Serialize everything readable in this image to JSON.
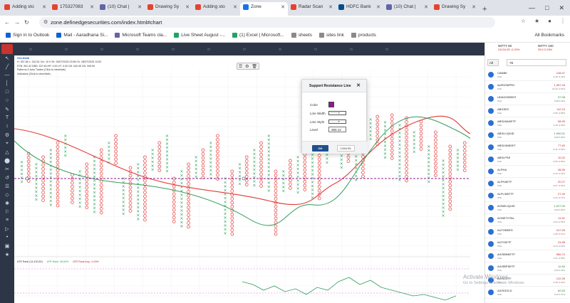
{
  "browser": {
    "tabs": [
      {
        "label": "Adding sto",
        "color": "#e5432f"
      },
      {
        "label": "175327083",
        "color": "#e5432f"
      },
      {
        "label": "(10) Chat |",
        "color": "#6264a7"
      },
      {
        "label": "Drawing Sy",
        "color": "#e5432f"
      },
      {
        "label": "Adding sto",
        "color": "#e5432f"
      },
      {
        "label": "Zone",
        "color": "#1a73e8",
        "active": true
      },
      {
        "label": "Radar Scan",
        "color": "#e5432f"
      },
      {
        "label": "HDFC Bank",
        "color": "#004c8f"
      },
      {
        "label": "(10) Chat |",
        "color": "#6264a7"
      },
      {
        "label": "Drawing Sy",
        "color": "#e5432f"
      }
    ],
    "url": "zone.definedgesecurities.com/index.html#chart",
    "bookmarks": [
      {
        "label": "Sign in to Outlook",
        "color": "#0a64d6"
      },
      {
        "label": "Mail - Aaradhana Si...",
        "color": "#0a64d6"
      },
      {
        "label": "Microsoft Teams cla...",
        "color": "#6264a7"
      },
      {
        "label": "Live Sheet August -...",
        "color": "#21a366"
      },
      {
        "label": "(1) Excel | Microsoft...",
        "color": "#21a366"
      },
      {
        "label": "sheets",
        "color": "#8a8a8a"
      },
      {
        "label": "sites link",
        "color": "#8a8a8a"
      },
      {
        "label": "products",
        "color": "#8a8a8a"
      }
    ],
    "all_bookmarks": "All Bookmarks"
  },
  "nav": {
    "items": [
      "",
      "",
      "",
      "",
      "",
      "",
      "",
      "",
      "",
      "",
      ""
    ]
  },
  "chart": {
    "symbol": "GOLDIAM",
    "line2": "H: 357.86 L: 342.81 Cm: 10 H Dr: 28/07/2025 23:58 Ch: 28/07/2025 13:53",
    "line3": "ETB: 351.42 DBD: 337.69 HP: 0.00 LP: 0.00 CB: 340.45 CB: 345.99",
    "line4": "Patterns & Auto Trades (Click to view/hide)",
    "line5": "Indicators (Click to view/hide)",
    "osc_label": "ATR Rank (14,100,50)",
    "osc_atr": "ATR Rank: 38.84%",
    "osc_avg": "ATR Rank Avg: -0.09%",
    "sr_level": 350.12,
    "colors": {
      "red": "#e53935",
      "green": "#2e9d5b",
      "sr": "#8e1a8e"
    }
  },
  "dialog": {
    "title": "Support Resistance Line",
    "color_label": "Color",
    "width_label": "Line Width",
    "style_label": "Line Style",
    "level_label": "Level",
    "level_value": "350.12",
    "ok": "OK",
    "cancel": "CANCEL",
    "swatch_color": "#8e1a8e"
  },
  "watchlist": {
    "nifty50": {
      "name": "NIFTY 50",
      "value": "24134.55 -0.20%"
    },
    "nifty100": {
      "name": "NIFTY 100",
      "value": "25.0 0.25%"
    },
    "filter": "All",
    "search": "78",
    "items": [
      {
        "name": "CANBK",
        "sub": "NSE",
        "price": "108.47",
        "chg": "-0.48 -0.44%",
        "up": false
      },
      {
        "name": "AURIONPRO",
        "sub": "NSE",
        "price": "1,357.45",
        "chg": "34.45 -2.51%",
        "up": false
      },
      {
        "name": "UDAICEMENT",
        "sub": "NSE",
        "price": "37.08",
        "chg": "0.08 0.22%",
        "up": true
      },
      {
        "name": "ABGSEC",
        "sub": "NSE",
        "price": "112.19",
        "chg": "-0.65 -0.58%",
        "up": false
      },
      {
        "name": "ABSLBANETF",
        "sub": "NSE",
        "price": "58.99",
        "chg": "-0.18 -0.30%",
        "up": false
      },
      {
        "name": "ABSLLIQUID",
        "sub": "NSE",
        "price": "1,000.01",
        "chg": "0.00 0.00%",
        "up": true
      },
      {
        "name": "ABSLNN50ET",
        "sub": "NSE",
        "price": "77.60",
        "chg": "-0.41 -0.52%",
        "up": false
      },
      {
        "name": "ABSLPSE",
        "sub": "NSE",
        "price": "10.02",
        "chg": "-0.05 -0.50%",
        "up": false
      },
      {
        "name": "ALPHA",
        "sub": "NSE",
        "price": "38.55",
        "chg": "-0.12 -0.31%",
        "up": false
      },
      {
        "name": "ALPHAETF",
        "sub": "NSE",
        "price": "20.27",
        "chg": "-0.07 -0.34%",
        "up": false
      },
      {
        "name": "ALPL30IETF",
        "sub": "NSE",
        "price": "27.49",
        "chg": "-0.13 -0.47%",
        "up": false
      },
      {
        "name": "AONELIQUID",
        "sub": "NSE",
        "price": "1,027.00",
        "chg": "0.00 0.00%",
        "up": true
      },
      {
        "name": "AONETOTAL",
        "sub": "NSE",
        "price": "11.61",
        "chg": "-0.04 -0.34%",
        "up": false
      },
      {
        "name": "AUTOBEES",
        "sub": "NSE",
        "price": "247.50",
        "chg": "-1.68 -0.67%",
        "up": false
      },
      {
        "name": "AUTOIETF",
        "sub": "NSE",
        "price": "24.68",
        "chg": "-0.13 -0.52%",
        "up": false
      },
      {
        "name": "AXISBNKETF",
        "sub": "NSE",
        "price": "566.74",
        "chg": "-3.11 -0.55%",
        "up": false
      },
      {
        "name": "AXISBPSETF",
        "sub": "NSE",
        "price": "12.84",
        "chg": "0.02 0.16%",
        "up": true
      },
      {
        "name": "AXISCETF",
        "sub": "NSE",
        "price": "122.39",
        "chg": "-0.18 -0.15%",
        "up": false
      },
      {
        "name": "AXISGOLD",
        "sub": "NSE",
        "price": "82.63",
        "chg": "0.22 0.27%",
        "up": true
      }
    ]
  },
  "windows_watermark": {
    "line1": "Activate Windows",
    "line2": "Go to Settings to activate Windows."
  }
}
